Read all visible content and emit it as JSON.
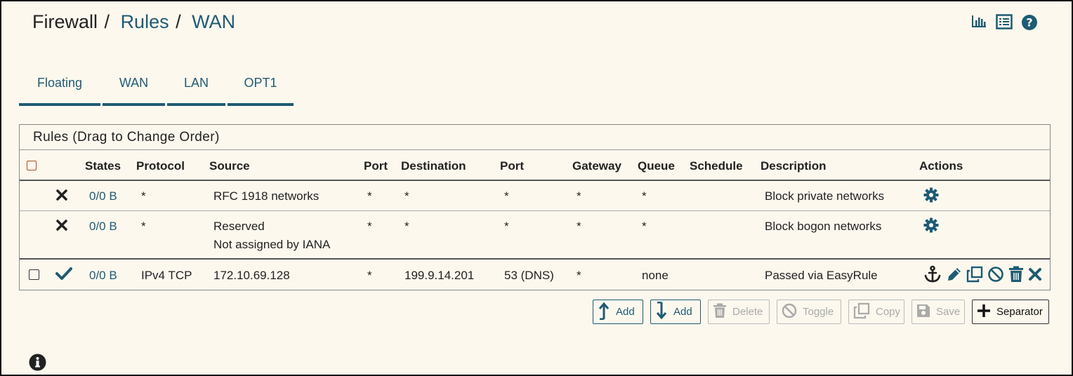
{
  "breadcrumb": {
    "part1": "Firewall",
    "sep1": "/",
    "part2": "Rules",
    "sep2": "/",
    "part3": "WAN"
  },
  "header_icons": [
    "chart-icon",
    "list-icon",
    "help-icon"
  ],
  "tabs": [
    {
      "label": "Floating"
    },
    {
      "label": "WAN"
    },
    {
      "label": "LAN"
    },
    {
      "label": "OPT1"
    }
  ],
  "panel": {
    "title": "Rules (Drag to Change Order)"
  },
  "columns": {
    "states": "States",
    "protocol": "Protocol",
    "source": "Source",
    "port": "Port",
    "destination": "Destination",
    "dport": "Port",
    "gateway": "Gateway",
    "queue": "Queue",
    "schedule": "Schedule",
    "description": "Description",
    "actions": "Actions"
  },
  "rows": [
    {
      "status": "blocked",
      "states": "0/0 B",
      "protocol": "*",
      "source": "RFC 1918 networks",
      "source2": "",
      "port": "*",
      "destination": "*",
      "dport": "*",
      "gateway": "*",
      "queue": "*",
      "schedule": "",
      "description": "Block private networks"
    },
    {
      "status": "blocked",
      "states": "0/0 B",
      "protocol": "*",
      "source": "Reserved",
      "source2": "Not assigned by IANA",
      "port": "*",
      "destination": "*",
      "dport": "*",
      "gateway": "*",
      "queue": "*",
      "schedule": "",
      "description": "Block bogon networks"
    },
    {
      "status": "pass",
      "states": "0/0 B",
      "protocol": "IPv4 TCP",
      "source": "172.10.69.128",
      "source2": "",
      "port": "*",
      "destination": "199.9.14.201",
      "dport": "53 (DNS)",
      "gateway": "*",
      "queue": "none",
      "schedule": "",
      "description": "Passed via EasyRule"
    }
  ],
  "buttons": {
    "add_top": "Add",
    "add_bottom": "Add",
    "delete": "Delete",
    "toggle": "Toggle",
    "copy": "Copy",
    "save": "Save",
    "separator": "Separator"
  },
  "colors": {
    "accent": "#1e5b74",
    "background": "#fdf8ee",
    "checkbox_header": "#b5481f"
  }
}
